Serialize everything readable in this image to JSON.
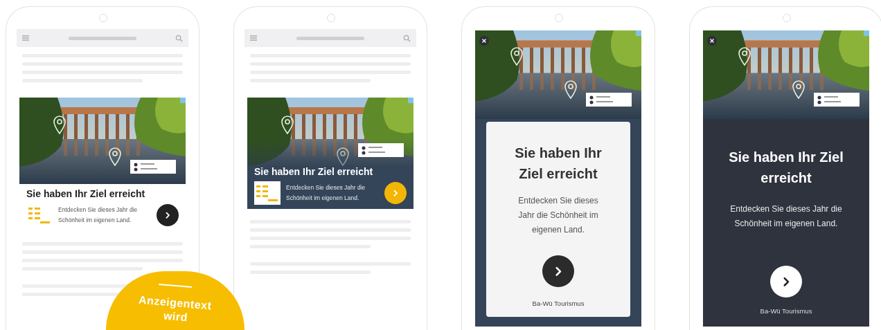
{
  "phones": [
    {
      "kind": "banner",
      "ad": {
        "headline": "Sie haben Ihr Ziel erreicht",
        "body": "Entdecken Sie dieses Jahr die Schönheit im eigenen Land."
      }
    },
    {
      "kind": "overlay",
      "ad": {
        "headline": "Sie haben Ihr Ziel erreicht",
        "body": "Entdecken Sie dieses Jahr die Schönheit im eigenen Land."
      }
    },
    {
      "kind": "card",
      "ad": {
        "headline": "Sie haben Ihr Ziel erreicht",
        "body": "Entdecken Sie dieses Jahr die Schönheit im eigenen Land.",
        "advertiser": "Ba-Wü Tourismus"
      }
    },
    {
      "kind": "fullscreen",
      "ad": {
        "headline": "Sie haben Ihr Ziel erreicht",
        "body": "Entdecken Sie dieses Jahr die Schönheit im eigenen Land.",
        "advertiser": "Ba-Wü Tourismus"
      }
    }
  ],
  "callout": {
    "lines": [
      "Anzeigentext",
      "wird"
    ]
  }
}
